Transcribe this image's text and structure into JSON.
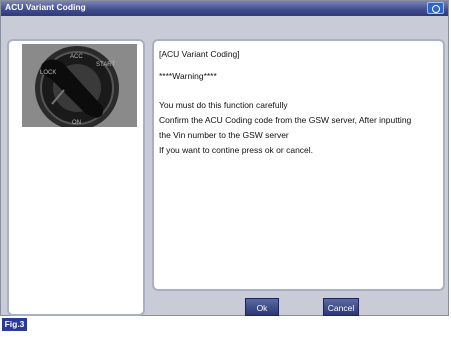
{
  "window": {
    "title": "ACU Variant Coding"
  },
  "message": {
    "heading": "[ACU Variant Coding]",
    "warning": "****Warning****",
    "line1": "You must do this function carefully",
    "line2": "Confirm the ACU Coding code from the GSW server, After inputting",
    "line3": "the Vin number to the GSW server",
    "line4": "If you want to contine press ok or cancel."
  },
  "buttons": {
    "ok": "Ok",
    "cancel": "Cancel"
  },
  "figure_label": "Fig.3",
  "icons": {
    "titlebar": "camera-icon",
    "photo": "ignition-key-switch"
  },
  "colors": {
    "titlebar": "#3f4b8c",
    "window": "#c9ccd6",
    "button": "#2a3775",
    "fig_badge": "#2a3a9a"
  }
}
